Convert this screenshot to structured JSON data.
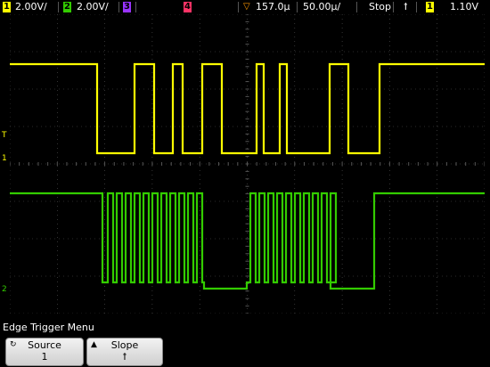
{
  "status_bar": {
    "ch1_num": "1",
    "ch1_scale": "2.00V/",
    "ch2_num": "2",
    "ch2_scale": "2.00V/",
    "ch3_num": "3",
    "ch4_num": "4",
    "trigger_pos_symbol": "▽",
    "time_offset": "157.0µ",
    "time_scale": "50.00µ/",
    "run_state": "Stop",
    "trigger_edge_symbol": "ꝉ",
    "trigger_source_num": "1",
    "trigger_level": "1.10V"
  },
  "colors": {
    "ch1": "#ffff00",
    "ch2": "#33cc00",
    "ch3": "#9933ff",
    "ch4": "#ff3366",
    "grid": "#555555"
  },
  "markers": {
    "trigger_level": "T",
    "ch1_ground": "1",
    "ch2_ground": "2"
  },
  "menu": {
    "title": "Edge Trigger Menu",
    "softkeys": [
      {
        "label": "Source",
        "value": "1",
        "icon": "softkey-rotate-icon"
      },
      {
        "label": "Slope",
        "value": "ꝉ",
        "icon": "softkey-up-arrow-icon"
      }
    ]
  }
}
